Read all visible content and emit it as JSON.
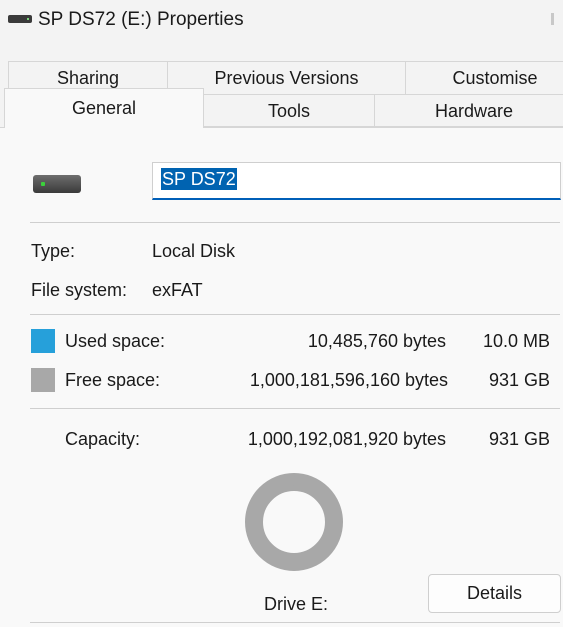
{
  "window": {
    "title": "SP DS72 (E:) Properties",
    "title_icon": "drive-icon"
  },
  "tabs": {
    "row1": [
      "Sharing",
      "Previous Versions",
      "Customise"
    ],
    "row2": [
      "General",
      "Tools",
      "Hardware"
    ],
    "active": "General"
  },
  "general": {
    "drive_icon": "drive-icon",
    "name": "SP DS72",
    "type_label": "Type:",
    "type_value": "Local Disk",
    "fs_label": "File system:",
    "fs_value": "exFAT",
    "used": {
      "label": "Used space:",
      "bytes": "10,485,760 bytes",
      "size": "10.0 MB",
      "color": "#26a0da"
    },
    "free": {
      "label": "Free space:",
      "bytes": "1,000,181,596,160 bytes",
      "size": "931 GB",
      "color": "#a8a8a8"
    },
    "capacity": {
      "label": "Capacity:",
      "bytes": "1,000,192,081,920 bytes",
      "size": "931 GB"
    },
    "used_fraction": 1e-05,
    "drive_label": "Drive E:",
    "details_button": "Details"
  }
}
